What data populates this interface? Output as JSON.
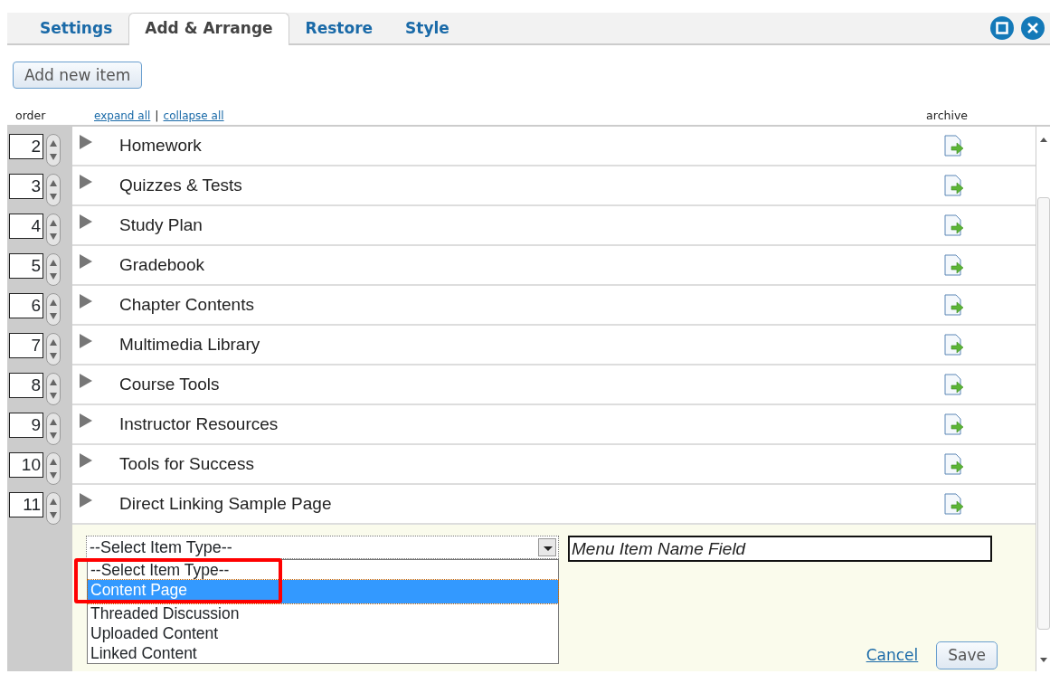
{
  "tabs": [
    {
      "label": "Settings",
      "selected": false
    },
    {
      "label": "Add & Arrange",
      "selected": true
    },
    {
      "label": "Restore",
      "selected": false
    },
    {
      "label": "Style",
      "selected": false
    }
  ],
  "add_button": "Add new item",
  "header": {
    "order": "order",
    "expand_all": "expand all",
    "separator": "|",
    "collapse_all": "collapse all",
    "archive": "archive"
  },
  "items": [
    {
      "order": "2",
      "title": "Homework"
    },
    {
      "order": "3",
      "title": "Quizzes & Tests"
    },
    {
      "order": "4",
      "title": "Study Plan"
    },
    {
      "order": "5",
      "title": "Gradebook"
    },
    {
      "order": "6",
      "title": "Chapter Contents"
    },
    {
      "order": "7",
      "title": "Multimedia Library"
    },
    {
      "order": "8",
      "title": "Course Tools"
    },
    {
      "order": "9",
      "title": "Instructor Resources"
    },
    {
      "order": "10",
      "title": "Tools for Success"
    },
    {
      "order": "11",
      "title": "Direct Linking Sample Page"
    }
  ],
  "new_item": {
    "type_select": {
      "value": "--Select Item Type--",
      "options": [
        {
          "label": "--Select Item Type--",
          "highlighted": false
        },
        {
          "label": "Content Page",
          "highlighted": true
        },
        {
          "label": "Threaded Discussion",
          "highlighted": false
        },
        {
          "label": "Uploaded Content",
          "highlighted": false
        },
        {
          "label": "Linked Content",
          "highlighted": false
        }
      ]
    },
    "name_field": {
      "placeholder": "Menu Item Name Field"
    },
    "cancel": "Cancel",
    "save": "Save"
  }
}
